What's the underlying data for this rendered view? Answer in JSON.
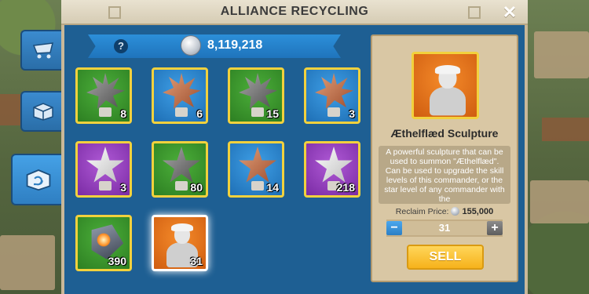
{
  "window": {
    "title": "ALLIANCE RECYCLING",
    "close_glyph": "✕"
  },
  "side_tabs": [
    {
      "icon": "shop-cart-icon",
      "active": false
    },
    {
      "icon": "resource-box-icon",
      "active": false
    },
    {
      "icon": "recycle-box-icon",
      "active": true
    }
  ],
  "resource": {
    "help_glyph": "?",
    "icon": "silver-gem-icon",
    "amount": "8,119,218"
  },
  "items": [
    {
      "type": "dark-spiky-star-sculpture",
      "bg": "green",
      "qty": "8"
    },
    {
      "type": "bronze-spiky-star-sculpture",
      "bg": "blue",
      "qty": "6"
    },
    {
      "type": "dark-spiky-star-sculpture",
      "bg": "green",
      "qty": "15"
    },
    {
      "type": "bronze-spiky-star-sculpture",
      "bg": "blue",
      "qty": "3"
    },
    {
      "type": "silver-star-sculpture",
      "bg": "purple",
      "qty": "3"
    },
    {
      "type": "dark-star-sculpture",
      "bg": "green",
      "qty": "80"
    },
    {
      "type": "bronze-star-sculpture",
      "bg": "blue",
      "qty": "14"
    },
    {
      "type": "silver-star-sculpture",
      "bg": "purple",
      "qty": "218"
    },
    {
      "type": "crystal-gem",
      "bg": "green",
      "qty": "390"
    },
    {
      "type": "commander-sculpture",
      "bg": "orange",
      "qty": "31",
      "selected": true
    }
  ],
  "detail": {
    "name": "Æthelflæd Sculpture",
    "description": "A powerful sculpture that can be used to summon \"Æthelflæd\". Can be used to upgrade the skill levels of this commander, or the star level of any commander with the",
    "reclaim_label": "Reclaim Price:",
    "reclaim_price": "155,000",
    "quantity": "31",
    "minus_glyph": "−",
    "plus_glyph": "+",
    "sell_label": "SELL"
  }
}
